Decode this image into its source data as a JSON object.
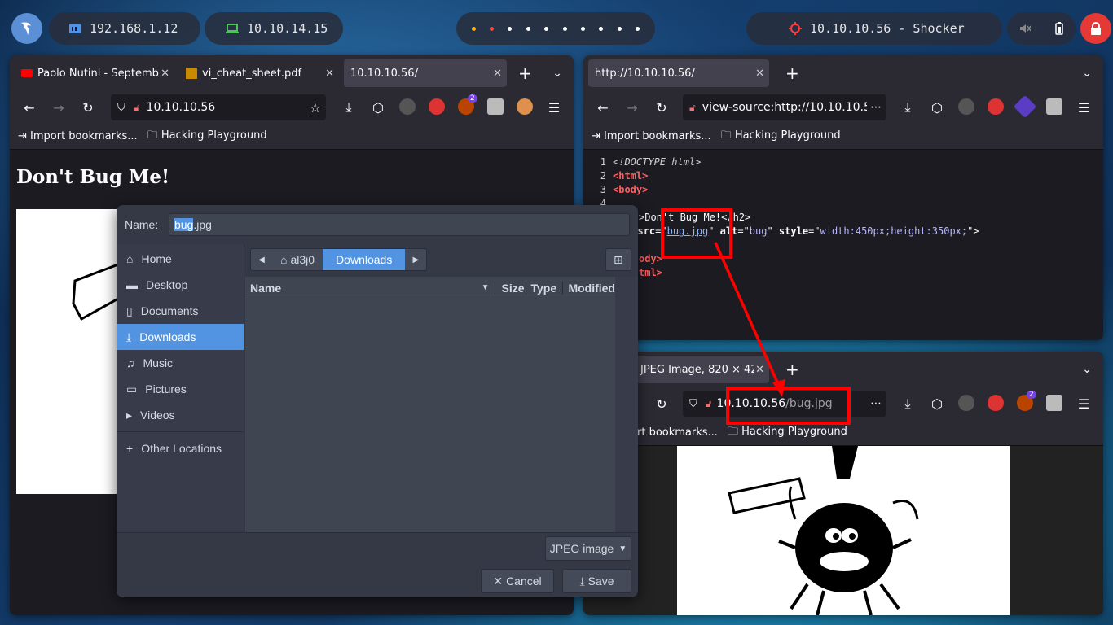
{
  "taskbar": {
    "ip_local": "192.168.1.12",
    "ip_vpn": "10.10.14.15",
    "target": "10.10.10.56 - Shocker"
  },
  "left_browser": {
    "tabs": [
      {
        "label": "Paolo Nutini - Septemb",
        "icon": "youtube-icon"
      },
      {
        "label": "vi_cheat_sheet.pdf",
        "icon": "pdf-icon"
      },
      {
        "label": "10.10.10.56/",
        "icon": ""
      }
    ],
    "url": "10.10.10.56",
    "bookmarks": [
      "Import bookmarks...",
      "Hacking Playground"
    ],
    "page_heading": "Don't Bug Me!",
    "ext_badge": "2"
  },
  "right_top_browser": {
    "tab": "http://10.10.10.56/",
    "url": "view-source:http://10.10.10.5",
    "bookmarks": [
      "Import bookmarks...",
      "Hacking Playground"
    ],
    "source_lines": [
      {
        "n": "1",
        "text": "<!DOCTYPE html>"
      },
      {
        "n": "2",
        "text": "<html>"
      },
      {
        "n": "3",
        "text": "<body>"
      },
      {
        "n": "4",
        "text": ""
      },
      {
        "n": "",
        "text": ">Don't Bug Me!</h2>"
      },
      {
        "n": "",
        "text": "g src=\"bug.jpg\" alt=\"bug\" style=\"width:450px;height:350px;\">"
      },
      {
        "n": "",
        "text": ""
      },
      {
        "n": "",
        "text": "ody>"
      },
      {
        "n": "",
        "text": "tml>"
      }
    ],
    "src_value": "bug.jpg",
    "alt_value": "bug",
    "style_value": "width:450px;height:350px;"
  },
  "right_bottom_browser": {
    "tab": "JPEG Image, 820 × 42",
    "url_host": "10.10.10.56",
    "url_path": "/bug.jpg",
    "bookmarks": [
      "rt bookmarks...",
      "Hacking Playground"
    ],
    "ext_badge": "2"
  },
  "save_dialog": {
    "name_label": "Name:",
    "filename_selected": "bug",
    "filename_rest": ".jpg",
    "places": [
      {
        "label": "Home",
        "icon": "home-icon"
      },
      {
        "label": "Desktop",
        "icon": "desktop-icon"
      },
      {
        "label": "Documents",
        "icon": "documents-icon"
      },
      {
        "label": "Downloads",
        "icon": "download-icon"
      },
      {
        "label": "Music",
        "icon": "music-icon"
      },
      {
        "label": "Pictures",
        "icon": "pictures-icon"
      },
      {
        "label": "Videos",
        "icon": "videos-icon"
      }
    ],
    "other_locations": "Other Locations",
    "path": [
      "al3j0",
      "Downloads"
    ],
    "columns": [
      "Name",
      "Size",
      "Type",
      "Modified"
    ],
    "filter": "JPEG image",
    "cancel": "Cancel",
    "save": "Save"
  },
  "colors": {
    "accent": "#5294e2",
    "annotation": "#ff0000"
  }
}
